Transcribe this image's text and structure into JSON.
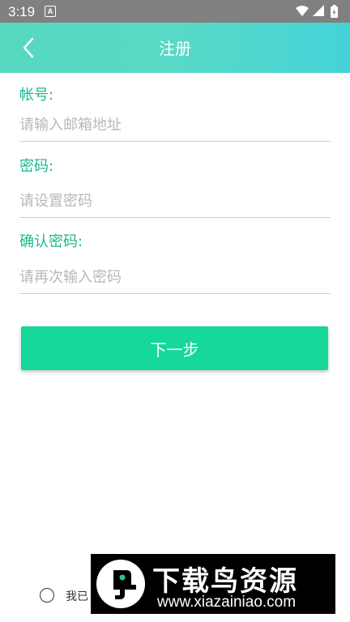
{
  "status_bar": {
    "time": "3:19",
    "notification_icon": "A",
    "icons": [
      "wifi-icon",
      "signal-icon",
      "battery-icon"
    ]
  },
  "header": {
    "title": "注册",
    "background_colors": [
      "#57d8c0",
      "#44d3d8"
    ]
  },
  "form": {
    "account": {
      "label": "帐号:",
      "placeholder": "请输入邮箱地址",
      "value": ""
    },
    "password": {
      "label": "密码:",
      "placeholder": "请设置密码",
      "value": ""
    },
    "confirm_password": {
      "label": "确认密码:",
      "placeholder": "请再次输入密码",
      "value": ""
    },
    "label_color": "#17b890"
  },
  "next_button": {
    "label": "下一步",
    "color": "#15d89a"
  },
  "agreement": {
    "text": "我已"
  },
  "watermark": {
    "brand": "下载鸟资源",
    "url": "www.xiazainiao.com"
  }
}
